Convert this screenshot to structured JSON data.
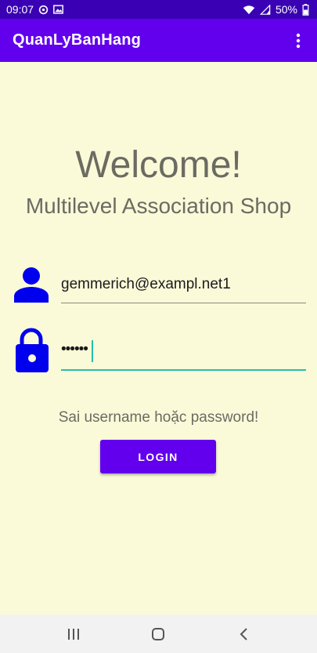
{
  "status_bar": {
    "time": "09:07",
    "battery": "50%",
    "icons": [
      "sync-icon",
      "image-icon",
      "wifi-icon",
      "signal-icon",
      "battery-icon"
    ]
  },
  "app_bar": {
    "title": "QuanLyBanHang",
    "overflow_icon": "more-vert-icon"
  },
  "login": {
    "welcome": "Welcome!",
    "shop_name": "Multilevel Association Shop",
    "email_value": "gemmerich@exampl.net1",
    "password_value": "••••••",
    "error_message": "Sai username hoặc password!",
    "login_label": "LOGIN",
    "user_icon": "person-icon",
    "lock_icon": "lock-icon"
  },
  "nav_bar": {
    "icons": [
      "recent-apps-icon",
      "home-icon",
      "back-icon"
    ]
  },
  "colors": {
    "status_bar": "#3a00b4",
    "app_bar": "#6200ee",
    "background": "#fafad9",
    "icon_blue": "#0000ee",
    "accent": "#26bfa6",
    "button": "#6200ee"
  }
}
